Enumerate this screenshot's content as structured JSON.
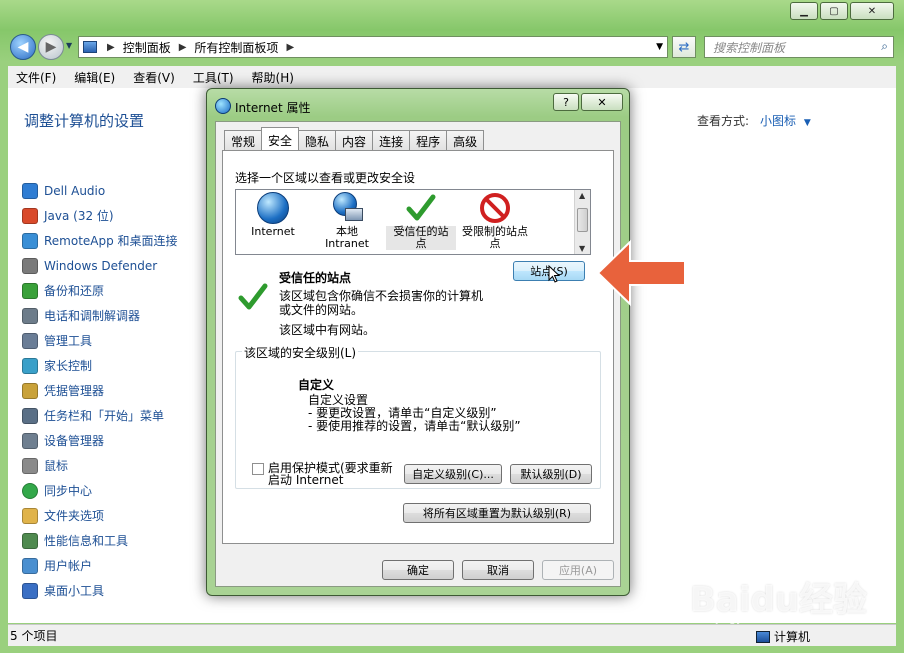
{
  "window": {
    "breadcrumb": [
      "控制面板",
      "所有控制面板项"
    ],
    "search_placeholder": "搜索控制面板",
    "menu": [
      "文件(F)",
      "编辑(E)",
      "查看(V)",
      "工具(T)",
      "帮助(H)"
    ],
    "page_title": "调整计算机的设置",
    "view_by_label": "查看方式:",
    "view_by_value": "小图标",
    "items": [
      {
        "label": "Dell Audio",
        "color": "#2f7dd3"
      },
      {
        "label": "Java (32 位)",
        "color": "#d94a2b"
      },
      {
        "label": "RemoteApp 和桌面连接",
        "color": "#3a8fd6"
      },
      {
        "label": "Windows Defender",
        "color": "#7a7a7a"
      },
      {
        "label": "备份和还原",
        "color": "#3aa13a"
      },
      {
        "label": "电话和调制解调器",
        "color": "#6d7c8a"
      },
      {
        "label": "管理工具",
        "color": "#6a7d96"
      },
      {
        "label": "家长控制",
        "color": "#3aa0c9"
      },
      {
        "label": "凭据管理器",
        "color": "#c9a23a"
      },
      {
        "label": "任务栏和「开始」菜单",
        "color": "#5a6f86"
      },
      {
        "label": "设备管理器",
        "color": "#6f7f90"
      },
      {
        "label": "鼠标",
        "color": "#8a8a8a"
      },
      {
        "label": "同步中心",
        "color": "#33a84a"
      },
      {
        "label": "文件夹选项",
        "color": "#e0b34a"
      },
      {
        "label": "性能信息和工具",
        "color": "#4f8a4f"
      },
      {
        "label": "用户帐户",
        "color": "#4a8fd0"
      },
      {
        "label": "桌面小工具",
        "color": "#3a6fc4"
      }
    ],
    "status_count": "5 个项目",
    "status_computer": "计算机"
  },
  "dialog": {
    "title": "Internet 属性",
    "help_btn": "?",
    "close_btn": "✕",
    "tabs": [
      "常规",
      "安全",
      "隐私",
      "内容",
      "连接",
      "程序",
      "高级"
    ],
    "active_tab": "安全",
    "zone_prompt": "选择一个区域以查看或更改安全设",
    "zones": [
      {
        "label1": "Internet",
        "label2": ""
      },
      {
        "label1": "本地",
        "label2": "Intranet"
      },
      {
        "label1": "受信任的站",
        "label2": "点"
      },
      {
        "label1": "受限制的站点",
        "label2": "点"
      }
    ],
    "selected_zone_name": "受信任的站点",
    "selected_zone_desc": "该区域包含你确信不会损害你的计算机或文件的网站。",
    "selected_zone_has": "该区域中有网站。",
    "sites_button": "站点(S)",
    "security_level_legend": "该区域的安全级别(L)",
    "custom_title": "自定义",
    "custom_lines": [
      "自定义设置",
      "- 要更改设置，请单击“自定义级别”",
      "- 要使用推荐的设置，请单击“默认级别”"
    ],
    "protected_mode_label": "启用保护模式(要求重新启动 Internet",
    "custom_level_btn": "自定义级别(C)...",
    "default_level_btn": "默认级别(D)",
    "reset_all_btn": "将所有区域重置为默认级别(R)",
    "ok_btn": "确定",
    "cancel_btn": "取消",
    "apply_btn": "应用(A)"
  },
  "watermark": {
    "brand": "Baidu经验",
    "url": "jingyan.baidu.com"
  }
}
